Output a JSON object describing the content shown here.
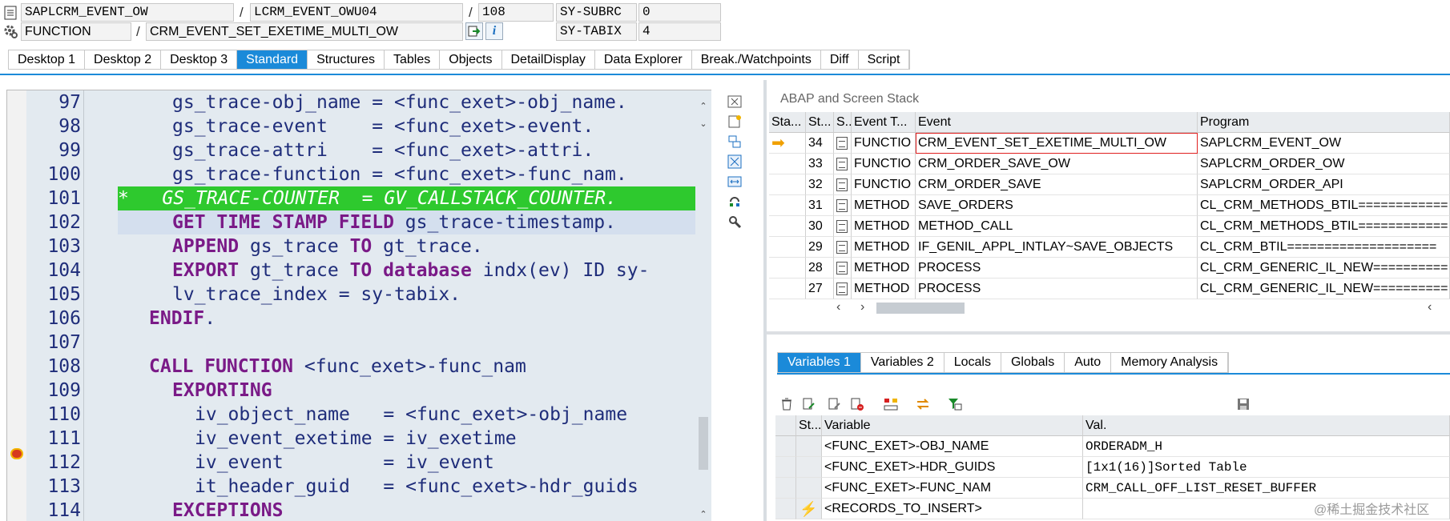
{
  "header": {
    "program": "SAPLCRM_EVENT_OW",
    "include": "LCRM_EVENT_OWU04",
    "line": "108",
    "subrc_label": "SY-SUBRC",
    "subrc_value": "0",
    "proc_type": "FUNCTION",
    "proc_name": "CRM_EVENT_SET_EXETIME_MULTI_OW",
    "tabix_label": "SY-TABIX",
    "tabix_value": "4",
    "separator": "/"
  },
  "tabs": [
    "Desktop 1",
    "Desktop 2",
    "Desktop 3",
    "Standard",
    "Structures",
    "Tables",
    "Objects",
    "DetailDisplay",
    "Data Explorer",
    "Break./Watchpoints",
    "Diff",
    "Script"
  ],
  "active_tab": "Standard",
  "code": {
    "lines": [
      {
        "num": "97",
        "text": "gs_trace-obj_name = <func_exet>-obj_name."
      },
      {
        "num": "98",
        "text": "gs_trace-event    = <func_exet>-event."
      },
      {
        "num": "99",
        "text": "gs_trace-attri    = <func_exet>-attri."
      },
      {
        "num": "100",
        "text": "gs_trace-function = <func_exet>-func_nam."
      },
      {
        "num": "101",
        "text": "*   GS_TRACE-COUNTER  = GV_CALLSTACK_COUNTER."
      },
      {
        "num": "102",
        "kw1": "GET TIME STAMP FIELD",
        "text": " gs_trace-timestamp."
      },
      {
        "num": "103",
        "kw1": "APPEND",
        "text_a": " gs_trace ",
        "kw2": "TO",
        "text": " gt_trace."
      },
      {
        "num": "104",
        "kw1": "EXPORT",
        "text_a": " gt_trace ",
        "kw2": "TO database",
        "text": " indx(ev) ID sy-"
      },
      {
        "num": "105",
        "text": "lv_trace_index = sy-tabix."
      },
      {
        "num": "106",
        "kw1": "ENDIF",
        "text": "."
      },
      {
        "num": "107",
        "text": ""
      },
      {
        "num": "108",
        "kw1": "CALL FUNCTION",
        "text": " <func_exet>-func_nam"
      },
      {
        "num": "109",
        "kw1": "EXPORTING",
        "text": ""
      },
      {
        "num": "110",
        "text": "iv_object_name   = <func_exet>-obj_name"
      },
      {
        "num": "111",
        "text": "iv_event_exetime = iv_exetime"
      },
      {
        "num": "112",
        "text": "iv_event         = iv_event"
      },
      {
        "num": "113",
        "text": "it_header_guid   = <func_exet>-hdr_guids"
      },
      {
        "num": "114",
        "kw1": "EXCEPTIONS",
        "text": ""
      }
    ]
  },
  "stack": {
    "title": "ABAP and Screen Stack",
    "columns": [
      "Sta...",
      "St...",
      "S...",
      "Event T...",
      "Event",
      "Program"
    ],
    "rows": [
      {
        "level": "34",
        "type": "FUNCTIO",
        "event": "CRM_EVENT_SET_EXETIME_MULTI_OW",
        "program": "SAPLCRM_EVENT_OW",
        "current": true
      },
      {
        "level": "33",
        "type": "FUNCTIO",
        "event": "CRM_ORDER_SAVE_OW",
        "program": "SAPLCRM_ORDER_OW"
      },
      {
        "level": "32",
        "type": "FUNCTIO",
        "event": "CRM_ORDER_SAVE",
        "program": "SAPLCRM_ORDER_API"
      },
      {
        "level": "31",
        "type": "METHOD",
        "event": "SAVE_ORDERS",
        "program": "CL_CRM_METHODS_BTIL============"
      },
      {
        "level": "30",
        "type": "METHOD",
        "event": "METHOD_CALL",
        "program": "CL_CRM_METHODS_BTIL============"
      },
      {
        "level": "29",
        "type": "METHOD",
        "event": "IF_GENIL_APPL_INTLAY~SAVE_OBJECTS",
        "program": "CL_CRM_BTIL===================="
      },
      {
        "level": "28",
        "type": "METHOD",
        "event": "PROCESS",
        "program": "CL_CRM_GENERIC_IL_NEW=========="
      },
      {
        "level": "27",
        "type": "METHOD",
        "event": "PROCESS",
        "program": "CL_CRM_GENERIC_IL_NEW=========="
      }
    ]
  },
  "var_tabs": [
    "Variables 1",
    "Variables 2",
    "Locals",
    "Globals",
    "Auto",
    "Memory Analysis"
  ],
  "active_var_tab": "Variables 1",
  "variables": {
    "columns": [
      "St...",
      "Variable",
      "Val."
    ],
    "rows": [
      {
        "status": "",
        "variable": "<FUNC_EXET>-OBJ_NAME",
        "value": "ORDERADM_H"
      },
      {
        "status": "",
        "variable": "<FUNC_EXET>-HDR_GUIDS",
        "value": "[1x1(16)]Sorted Table"
      },
      {
        "status": "",
        "variable": "<FUNC_EXET>-FUNC_NAM",
        "value": "CRM_CALL_OFF_LIST_RESET_BUFFER"
      },
      {
        "status": "lightning",
        "variable": "<RECORDS_TO_INSERT>",
        "value": ""
      }
    ]
  },
  "watermark": "@稀土掘金技术社区",
  "colors": {
    "accent": "#1b8ad9",
    "green_highlight": "#2ec92e",
    "keyword": "#7a1a87",
    "code_text": "#1f2d7a"
  }
}
